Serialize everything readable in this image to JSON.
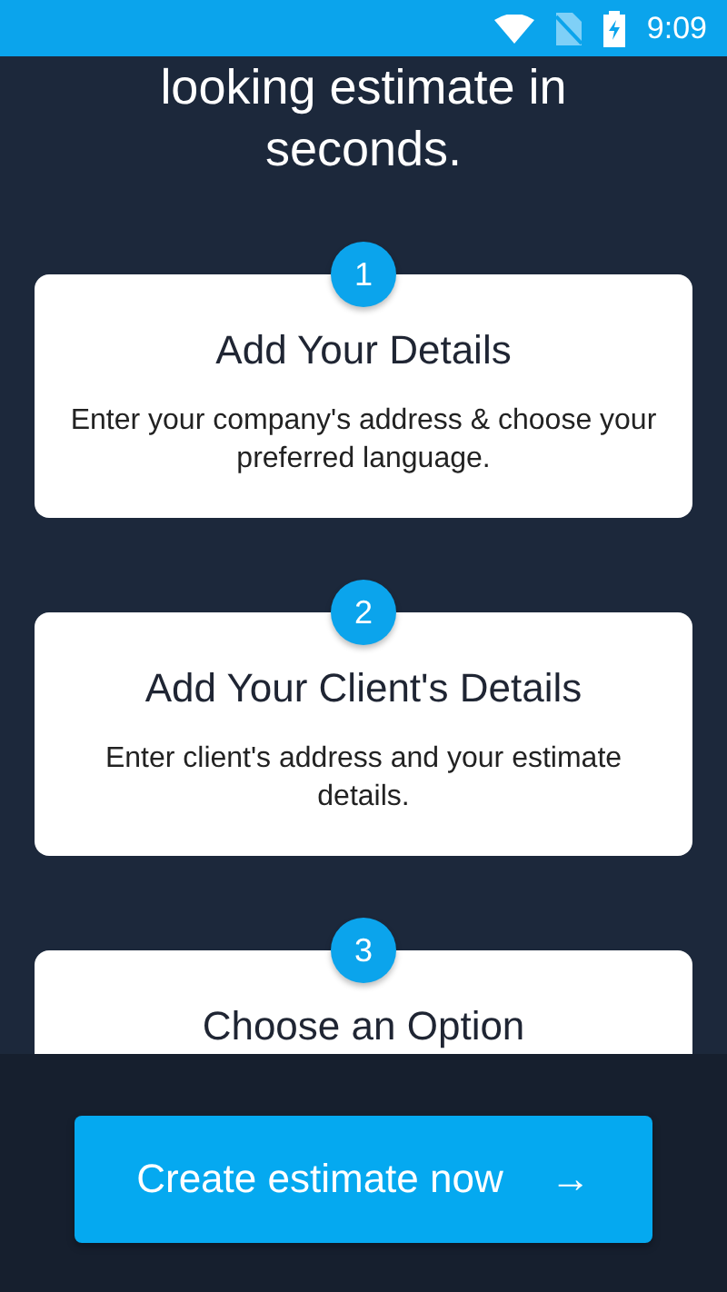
{
  "status_bar": {
    "time": "9:09"
  },
  "headline": "looking estimate in seconds.",
  "steps": [
    {
      "number": "1",
      "title": "Add Your Details",
      "description": "Enter your company's address & choose your preferred language."
    },
    {
      "number": "2",
      "title": "Add Your Client's Details",
      "description": "Enter client's address and your estimate details."
    },
    {
      "number": "3",
      "title": "Choose an Option"
    }
  ],
  "cta": {
    "label": "Create estimate now",
    "arrow": "→"
  }
}
